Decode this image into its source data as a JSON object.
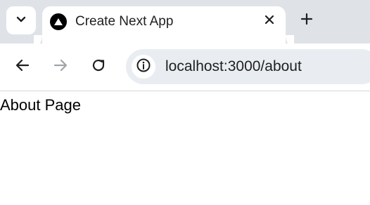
{
  "tab": {
    "title": "Create Next App"
  },
  "omnibox": {
    "url": "localhost:3000/about"
  },
  "page": {
    "text": "About Page"
  },
  "icons": {
    "tab_search": "chevron-down-icon",
    "favicon": "nextjs-triangle-icon",
    "close": "close-icon",
    "new_tab": "plus-icon",
    "back": "arrow-left-icon",
    "forward": "arrow-right-icon",
    "reload": "reload-icon",
    "site_info": "info-icon"
  },
  "colors": {
    "tabstrip": "#dfe3e8",
    "omnibox": "#e9edf1",
    "text": "#1f1f1f",
    "disabled": "#a0a4a8"
  }
}
